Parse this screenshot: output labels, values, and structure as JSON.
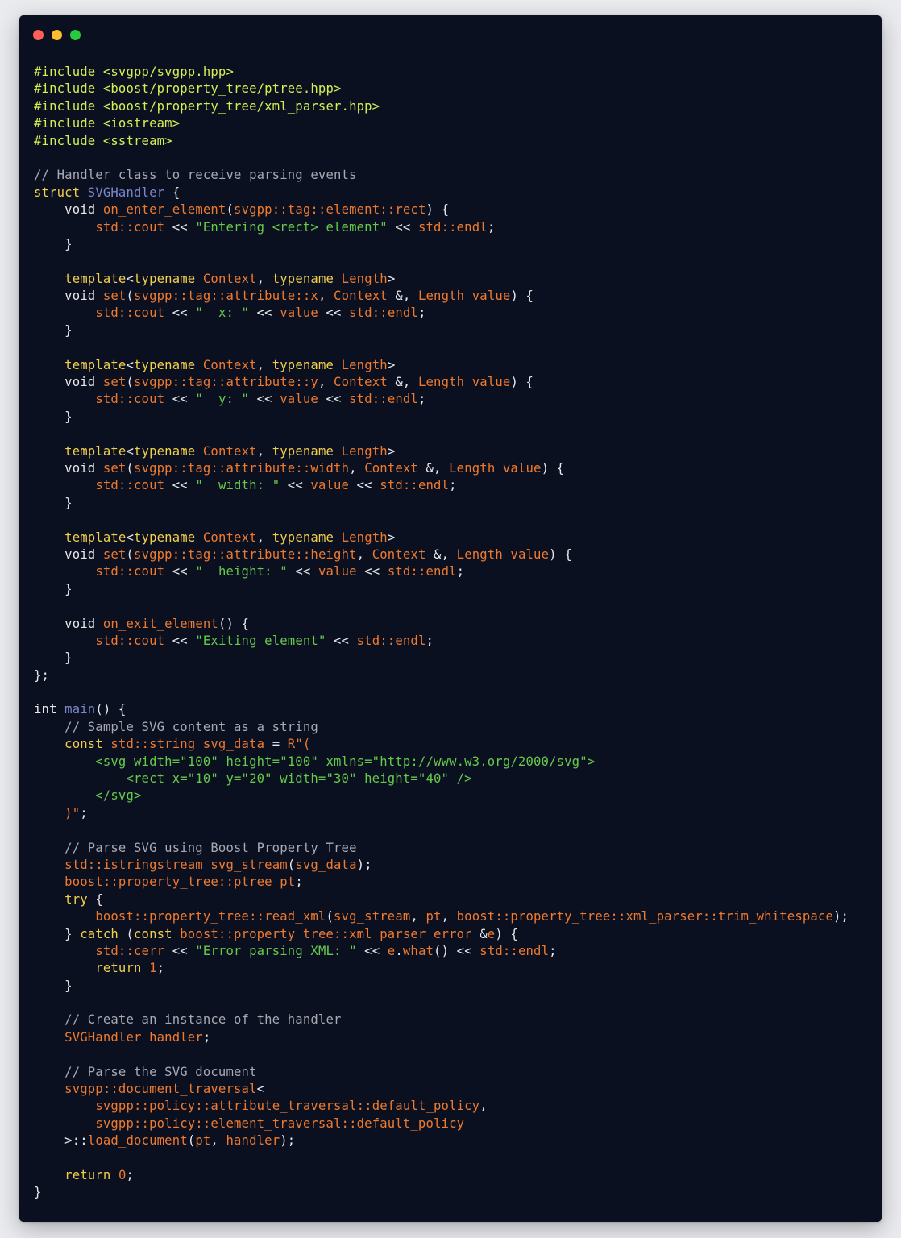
{
  "window": {
    "controls": [
      {
        "name": "close",
        "color": "#ff5f57"
      },
      {
        "name": "minimize",
        "color": "#febc2e"
      },
      {
        "name": "zoom",
        "color": "#28c840"
      }
    ]
  },
  "code_lines": [
    [
      [
        "include",
        "#include <svgpp/svgpp.hpp>"
      ]
    ],
    [
      [
        "include",
        "#include <boost/property_tree/ptree.hpp>"
      ]
    ],
    [
      [
        "include",
        "#include <boost/property_tree/xml_parser.hpp>"
      ]
    ],
    [
      [
        "include",
        "#include <iostream>"
      ]
    ],
    [
      [
        "include",
        "#include <sstream>"
      ]
    ],
    [],
    [
      [
        "comment",
        "// Handler class to receive parsing events"
      ]
    ],
    [
      [
        "keyword",
        "struct "
      ],
      [
        "funcname",
        "SVGHandler"
      ],
      [
        "plain",
        " {"
      ]
    ],
    [
      [
        "plain",
        "    void "
      ],
      [
        "orange",
        "on_enter_element"
      ],
      [
        "plain",
        "("
      ],
      [
        "orange",
        "svgpp::tag::element::rect"
      ],
      [
        "plain",
        ") {"
      ]
    ],
    [
      [
        "plain",
        "        "
      ],
      [
        "orange",
        "std::cout"
      ],
      [
        "plain",
        " << "
      ],
      [
        "string",
        "\"Entering <rect> element\""
      ],
      [
        "plain",
        " << "
      ],
      [
        "orange",
        "std::endl"
      ],
      [
        "plain",
        ";"
      ]
    ],
    [
      [
        "plain",
        "    }"
      ]
    ],
    [],
    [
      [
        "plain",
        "    "
      ],
      [
        "keyword",
        "template"
      ],
      [
        "plain",
        "<"
      ],
      [
        "keyword",
        "typename "
      ],
      [
        "orange",
        "Context"
      ],
      [
        "plain",
        ", "
      ],
      [
        "keyword",
        "typename "
      ],
      [
        "orange",
        "Length"
      ],
      [
        "plain",
        ">"
      ]
    ],
    [
      [
        "plain",
        "    void "
      ],
      [
        "orange",
        "set"
      ],
      [
        "plain",
        "("
      ],
      [
        "orange",
        "svgpp::tag::attribute::x"
      ],
      [
        "plain",
        ", "
      ],
      [
        "orange",
        "Context"
      ],
      [
        "plain",
        " &, "
      ],
      [
        "orange",
        "Length value"
      ],
      [
        "plain",
        ") {"
      ]
    ],
    [
      [
        "plain",
        "        "
      ],
      [
        "orange",
        "std::cout"
      ],
      [
        "plain",
        " << "
      ],
      [
        "string",
        "\"  x: \""
      ],
      [
        "plain",
        " << "
      ],
      [
        "orange",
        "value"
      ],
      [
        "plain",
        " << "
      ],
      [
        "orange",
        "std::endl"
      ],
      [
        "plain",
        ";"
      ]
    ],
    [
      [
        "plain",
        "    }"
      ]
    ],
    [],
    [
      [
        "plain",
        "    "
      ],
      [
        "keyword",
        "template"
      ],
      [
        "plain",
        "<"
      ],
      [
        "keyword",
        "typename "
      ],
      [
        "orange",
        "Context"
      ],
      [
        "plain",
        ", "
      ],
      [
        "keyword",
        "typename "
      ],
      [
        "orange",
        "Length"
      ],
      [
        "plain",
        ">"
      ]
    ],
    [
      [
        "plain",
        "    void "
      ],
      [
        "orange",
        "set"
      ],
      [
        "plain",
        "("
      ],
      [
        "orange",
        "svgpp::tag::attribute::y"
      ],
      [
        "plain",
        ", "
      ],
      [
        "orange",
        "Context"
      ],
      [
        "plain",
        " &, "
      ],
      [
        "orange",
        "Length value"
      ],
      [
        "plain",
        ") {"
      ]
    ],
    [
      [
        "plain",
        "        "
      ],
      [
        "orange",
        "std::cout"
      ],
      [
        "plain",
        " << "
      ],
      [
        "string",
        "\"  y: \""
      ],
      [
        "plain",
        " << "
      ],
      [
        "orange",
        "value"
      ],
      [
        "plain",
        " << "
      ],
      [
        "orange",
        "std::endl"
      ],
      [
        "plain",
        ";"
      ]
    ],
    [
      [
        "plain",
        "    }"
      ]
    ],
    [],
    [
      [
        "plain",
        "    "
      ],
      [
        "keyword",
        "template"
      ],
      [
        "plain",
        "<"
      ],
      [
        "keyword",
        "typename "
      ],
      [
        "orange",
        "Context"
      ],
      [
        "plain",
        ", "
      ],
      [
        "keyword",
        "typename "
      ],
      [
        "orange",
        "Length"
      ],
      [
        "plain",
        ">"
      ]
    ],
    [
      [
        "plain",
        "    void "
      ],
      [
        "orange",
        "set"
      ],
      [
        "plain",
        "("
      ],
      [
        "orange",
        "svgpp::tag::attribute::width"
      ],
      [
        "plain",
        ", "
      ],
      [
        "orange",
        "Context"
      ],
      [
        "plain",
        " &, "
      ],
      [
        "orange",
        "Length value"
      ],
      [
        "plain",
        ") {"
      ]
    ],
    [
      [
        "plain",
        "        "
      ],
      [
        "orange",
        "std::cout"
      ],
      [
        "plain",
        " << "
      ],
      [
        "string",
        "\"  width: \""
      ],
      [
        "plain",
        " << "
      ],
      [
        "orange",
        "value"
      ],
      [
        "plain",
        " << "
      ],
      [
        "orange",
        "std::endl"
      ],
      [
        "plain",
        ";"
      ]
    ],
    [
      [
        "plain",
        "    }"
      ]
    ],
    [],
    [
      [
        "plain",
        "    "
      ],
      [
        "keyword",
        "template"
      ],
      [
        "plain",
        "<"
      ],
      [
        "keyword",
        "typename "
      ],
      [
        "orange",
        "Context"
      ],
      [
        "plain",
        ", "
      ],
      [
        "keyword",
        "typename "
      ],
      [
        "orange",
        "Length"
      ],
      [
        "plain",
        ">"
      ]
    ],
    [
      [
        "plain",
        "    void "
      ],
      [
        "orange",
        "set"
      ],
      [
        "plain",
        "("
      ],
      [
        "orange",
        "svgpp::tag::attribute::height"
      ],
      [
        "plain",
        ", "
      ],
      [
        "orange",
        "Context"
      ],
      [
        "plain",
        " &, "
      ],
      [
        "orange",
        "Length value"
      ],
      [
        "plain",
        ") {"
      ]
    ],
    [
      [
        "plain",
        "        "
      ],
      [
        "orange",
        "std::cout"
      ],
      [
        "plain",
        " << "
      ],
      [
        "string",
        "\"  height: \""
      ],
      [
        "plain",
        " << "
      ],
      [
        "orange",
        "value"
      ],
      [
        "plain",
        " << "
      ],
      [
        "orange",
        "std::endl"
      ],
      [
        "plain",
        ";"
      ]
    ],
    [
      [
        "plain",
        "    }"
      ]
    ],
    [],
    [
      [
        "plain",
        "    void "
      ],
      [
        "orange",
        "on_exit_element"
      ],
      [
        "plain",
        "() {"
      ]
    ],
    [
      [
        "plain",
        "        "
      ],
      [
        "orange",
        "std::cout"
      ],
      [
        "plain",
        " << "
      ],
      [
        "string",
        "\"Exiting element\""
      ],
      [
        "plain",
        " << "
      ],
      [
        "orange",
        "std::endl"
      ],
      [
        "plain",
        ";"
      ]
    ],
    [
      [
        "plain",
        "    }"
      ]
    ],
    [
      [
        "plain",
        "};"
      ]
    ],
    [],
    [
      [
        "plain",
        "int "
      ],
      [
        "funcname",
        "main"
      ],
      [
        "plain",
        "() {"
      ]
    ],
    [
      [
        "comment",
        "    // Sample SVG content as a string"
      ]
    ],
    [
      [
        "plain",
        "    "
      ],
      [
        "keyword",
        "const "
      ],
      [
        "orange",
        "std::string svg_data"
      ],
      [
        "plain",
        " = "
      ],
      [
        "orange",
        "R\"("
      ]
    ],
    [
      [
        "string",
        "        <svg width=\"100\" height=\"100\" xmlns=\"http://www.w3.org/2000/svg\">"
      ]
    ],
    [
      [
        "string",
        "            <rect x=\"10\" y=\"20\" width=\"30\" height=\"40\" />"
      ]
    ],
    [
      [
        "string",
        "        </svg>"
      ]
    ],
    [
      [
        "orange",
        "    )\""
      ],
      [
        "plain",
        ";"
      ]
    ],
    [],
    [
      [
        "comment",
        "    // Parse SVG using Boost Property Tree"
      ]
    ],
    [
      [
        "plain",
        "    "
      ],
      [
        "orange",
        "std::istringstream svg_stream"
      ],
      [
        "plain",
        "("
      ],
      [
        "orange",
        "svg_data"
      ],
      [
        "plain",
        ");"
      ]
    ],
    [
      [
        "plain",
        "    "
      ],
      [
        "orange",
        "boost::property_tree::ptree pt"
      ],
      [
        "plain",
        ";"
      ]
    ],
    [
      [
        "plain",
        "    "
      ],
      [
        "keyword",
        "try"
      ],
      [
        "plain",
        " {"
      ]
    ],
    [
      [
        "plain",
        "        "
      ],
      [
        "orange",
        "boost::property_tree::read_xml"
      ],
      [
        "plain",
        "("
      ],
      [
        "orange",
        "svg_stream"
      ],
      [
        "plain",
        ", "
      ],
      [
        "orange",
        "pt"
      ],
      [
        "plain",
        ", "
      ],
      [
        "orange",
        "boost::property_tree::xml_parser::trim_whitespace"
      ],
      [
        "plain",
        ");"
      ]
    ],
    [
      [
        "plain",
        "    } "
      ],
      [
        "keyword",
        "catch"
      ],
      [
        "plain",
        " ("
      ],
      [
        "keyword",
        "const "
      ],
      [
        "orange",
        "boost::property_tree::xml_parser_error"
      ],
      [
        "plain",
        " &"
      ],
      [
        "orange",
        "e"
      ],
      [
        "plain",
        ") {"
      ]
    ],
    [
      [
        "plain",
        "        "
      ],
      [
        "orange",
        "std::cerr"
      ],
      [
        "plain",
        " << "
      ],
      [
        "string",
        "\"Error parsing XML: \""
      ],
      [
        "plain",
        " << "
      ],
      [
        "orange",
        "e"
      ],
      [
        "plain",
        "."
      ],
      [
        "orange",
        "what"
      ],
      [
        "plain",
        "() << "
      ],
      [
        "orange",
        "std::endl"
      ],
      [
        "plain",
        ";"
      ]
    ],
    [
      [
        "plain",
        "        "
      ],
      [
        "keyword",
        "return "
      ],
      [
        "number",
        "1"
      ],
      [
        "plain",
        ";"
      ]
    ],
    [
      [
        "plain",
        "    }"
      ]
    ],
    [],
    [
      [
        "comment",
        "    // Create an instance of the handler"
      ]
    ],
    [
      [
        "plain",
        "    "
      ],
      [
        "orange",
        "SVGHandler handler"
      ],
      [
        "plain",
        ";"
      ]
    ],
    [],
    [
      [
        "comment",
        "    // Parse the SVG document"
      ]
    ],
    [
      [
        "plain",
        "    "
      ],
      [
        "orange",
        "svgpp::document_traversal"
      ],
      [
        "plain",
        "<"
      ]
    ],
    [
      [
        "plain",
        "        "
      ],
      [
        "orange",
        "svgpp::policy::attribute_traversal::default_policy"
      ],
      [
        "plain",
        ","
      ]
    ],
    [
      [
        "plain",
        "        "
      ],
      [
        "orange",
        "svgpp::policy::element_traversal::default_policy"
      ]
    ],
    [
      [
        "plain",
        "    >::"
      ],
      [
        "orange",
        "load_document"
      ],
      [
        "plain",
        "("
      ],
      [
        "orange",
        "pt"
      ],
      [
        "plain",
        ", "
      ],
      [
        "orange",
        "handler"
      ],
      [
        "plain",
        ");"
      ]
    ],
    [],
    [
      [
        "plain",
        "    "
      ],
      [
        "keyword",
        "return "
      ],
      [
        "number",
        "0"
      ],
      [
        "plain",
        ";"
      ]
    ],
    [
      [
        "plain",
        "}"
      ]
    ]
  ]
}
